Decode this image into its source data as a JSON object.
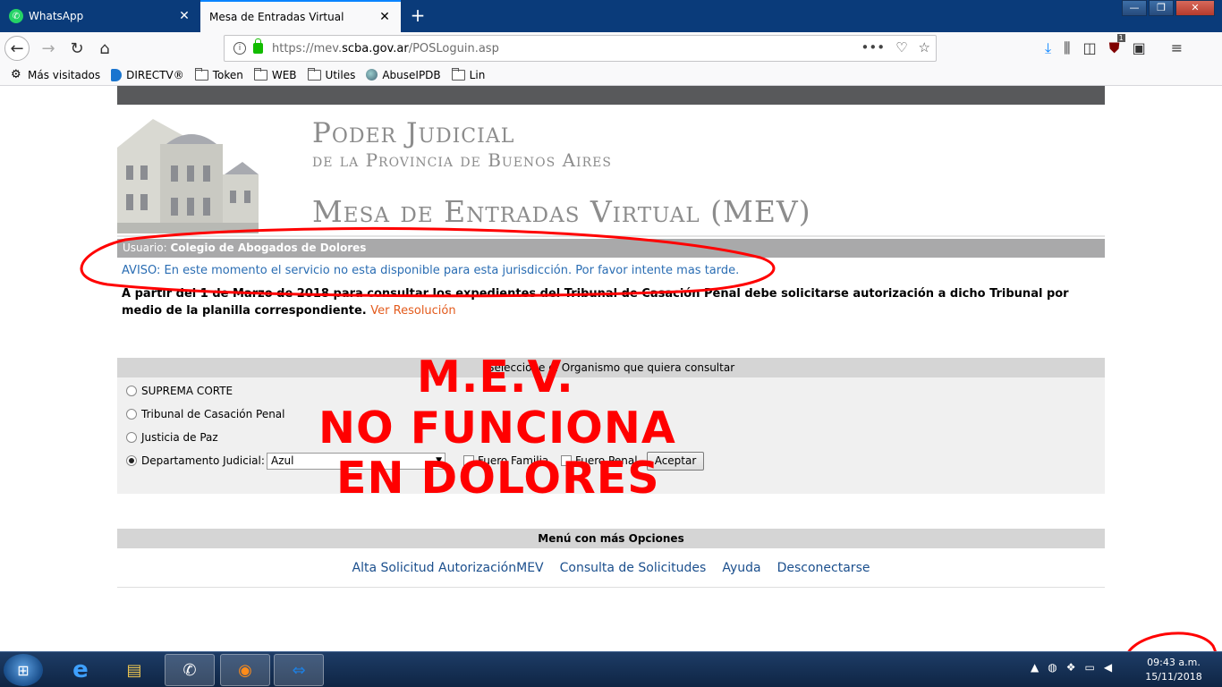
{
  "browser": {
    "tabs": [
      {
        "title": "WhatsApp",
        "active": false
      },
      {
        "title": "Mesa de Entradas Virtual",
        "active": true
      }
    ],
    "url_prefix": "https://mev.",
    "url_host": "scba.gov.ar",
    "url_path": "/POSLoguin.asp",
    "bookmarks": [
      "Más visitados",
      "DIRECTV®",
      "Token",
      "WEB",
      "Utiles",
      "AbuseIPDB",
      "Lin"
    ],
    "ublock_count": "1"
  },
  "header": {
    "line1": "Poder Judicial",
    "line2": "de la Provincia de Buenos Aires",
    "line3": "Mesa de Entradas Virtual (MEV)"
  },
  "user": {
    "label": "Usuario:",
    "name": "Colegio de Abogados de Dolores"
  },
  "aviso": "AVISO: En este momento el servicio no esta disponible para esta jurisdicción. Por favor intente mas tarde.",
  "notice": {
    "text": "A partir del 1 de Marzo de 2018 para consultar los expedientes del Tribunal de Casación Penal debe solicitarse autorización a dicho Tribunal por medio de la planilla correspondiente.",
    "link": "Ver Resolución"
  },
  "selector": {
    "heading": "Seleccione el Organismo que quiera consultar",
    "options": [
      "SUPREMA CORTE",
      "Tribunal de Casación Penal",
      "Justicia de Paz",
      "Departamento Judicial:"
    ],
    "selected_index": 3,
    "department_value": "Azul",
    "checkbox_familia": "Fuero Familia",
    "checkbox_penal": "Fuero Penal",
    "accept_label": "Aceptar"
  },
  "menu": {
    "heading": "Menú con más Opciones",
    "links": [
      "Alta Solicitud AutorizaciónMEV",
      "Consulta de Solicitudes",
      "Ayuda",
      "Desconectarse"
    ]
  },
  "overlay": {
    "line1": "M.E.V.",
    "line2": "NO FUNCIONA",
    "line3": "EN DOLORES"
  },
  "taskbar": {
    "time": "09:43 a.m.",
    "date": "15/11/2018"
  },
  "colors": {
    "annotation_red": "#ff0000",
    "aviso_blue": "#2a6db3",
    "link_orange": "#e35b1d"
  }
}
